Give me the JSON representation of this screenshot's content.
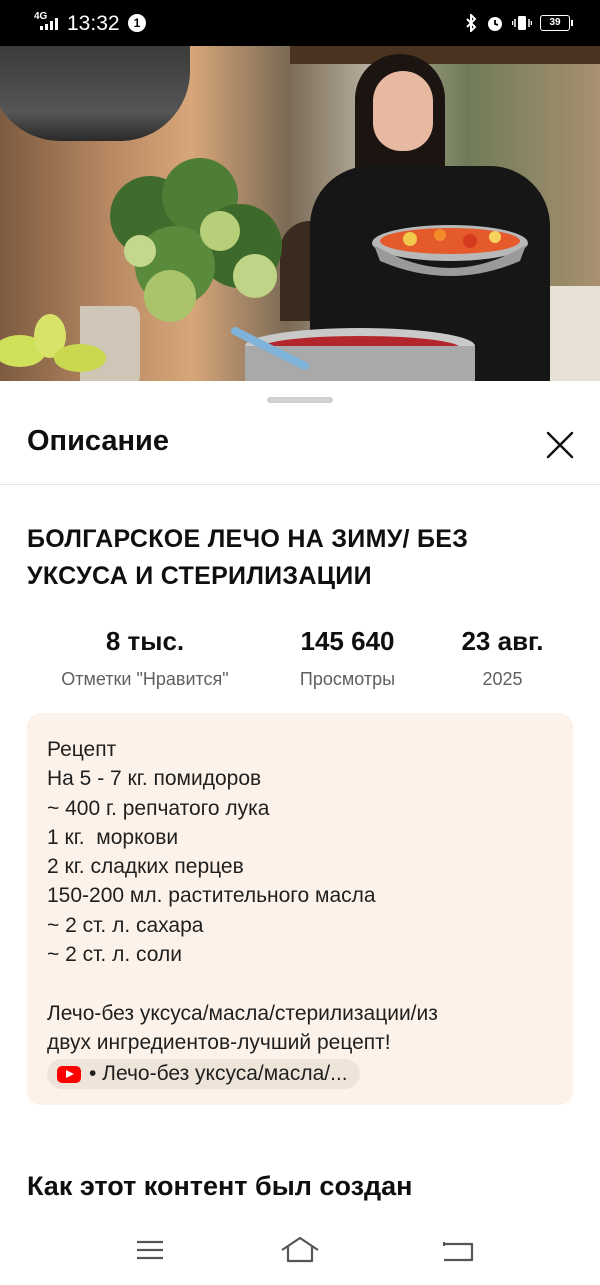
{
  "status_bar": {
    "network": "4G",
    "time": "13:32",
    "notification_badge": "1",
    "battery": "39",
    "icons": [
      "bluetooth-icon",
      "alarm-icon",
      "vibrate-icon",
      "battery-icon"
    ]
  },
  "video": {
    "progress_fraction": 0.44,
    "accent_color": "#ff0033"
  },
  "sheet": {
    "title": "Описание",
    "close_icon": "close-icon",
    "video_title": "БОЛГАРСКОЕ ЛЕЧО НА ЗИМУ/ БЕЗ УКСУСА И СТЕРИЛИЗАЦИИ",
    "stats": [
      {
        "value": "8 тыс.",
        "label": "Отметки \"Нравится\""
      },
      {
        "value": "145 640",
        "label": "Просмотры"
      },
      {
        "value": "23 авг.",
        "label": "2025"
      }
    ],
    "description_lines": [
      "Рецепт",
      "На 5 - 7 кг. помидоров",
      "~ 400 г. репчатого лука",
      "1 кг.  моркови",
      "2 кг. сладких перцев",
      "150-200 мл. растительного масла",
      "~ 2 ст. л. сахара",
      "~ 2 ст. л. соли"
    ],
    "description_extra": [
      "Лечо-без уксуса/масла/стерилизации/из",
      "двух ингредиентов-лучший рецепт!"
    ],
    "linked_video_chip": "• Лечо-без уксуса/масла/...",
    "section_heading": "Как этот контент был создан"
  },
  "navbar": {
    "icons": [
      "menu-icon",
      "home-icon",
      "back-icon"
    ]
  }
}
